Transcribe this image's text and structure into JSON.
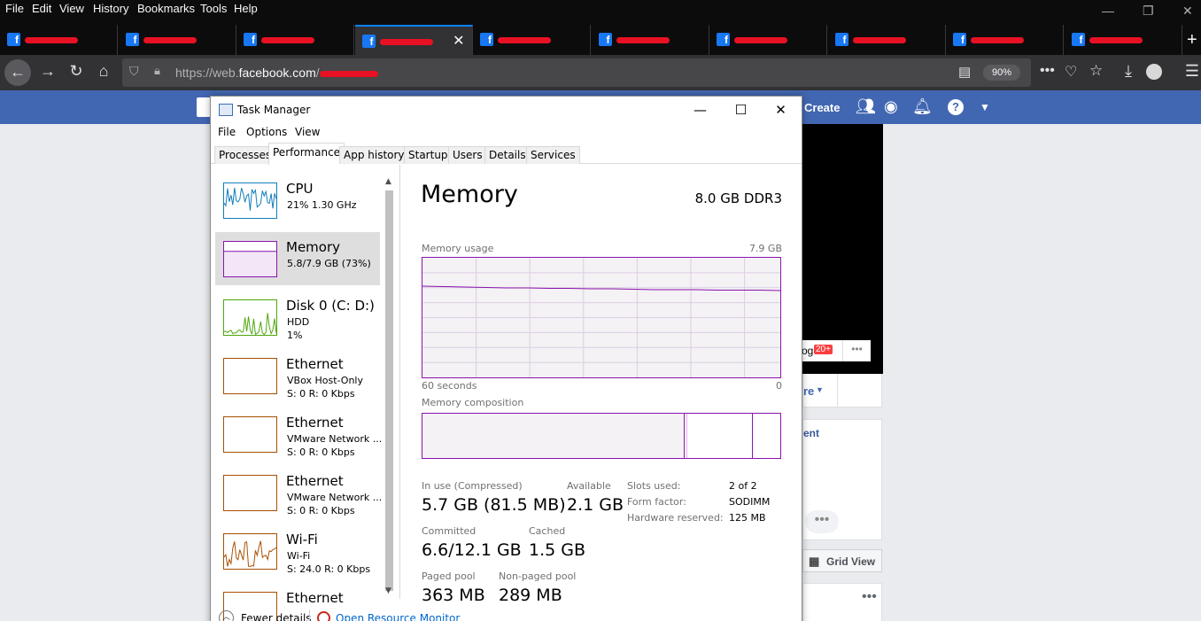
{
  "browser": {
    "menu": [
      "File",
      "Edit",
      "View",
      "History",
      "Bookmarks",
      "Tools",
      "Help"
    ],
    "url_prefix": "https://web.",
    "url_domain": "facebook.com",
    "url_suffix": "/",
    "zoom": "90%",
    "tab_count": 10,
    "active_tab_index": 3
  },
  "facebook": {
    "create_label": "Create",
    "badge_count": "20+",
    "badge_prefix": "og",
    "grid_view_label": "Grid View",
    "side_text_1": "re",
    "side_text_2": "ent",
    "brand_color": "#4267b2"
  },
  "taskmanager": {
    "title": "Task Manager",
    "menu": {
      "file": "File",
      "options": "Options",
      "view": "View"
    },
    "tabs": [
      "Processes",
      "Performance",
      "App history",
      "Startup",
      "Users",
      "Details",
      "Services"
    ],
    "active_tab": "Performance",
    "resources": [
      {
        "name": "CPU",
        "sub1": "21%  1.30 GHz",
        "sub2": "",
        "color": "#117dbb",
        "icon": "cpu-graph-icon"
      },
      {
        "name": "Memory",
        "sub1": "5.8/7.9 GB (73%)",
        "sub2": "",
        "color": "#8b12ae",
        "icon": "memory-graph-icon"
      },
      {
        "name": "Disk 0 (C: D:)",
        "sub1": "HDD",
        "sub2": "1%",
        "color": "#4da60c",
        "icon": "disk-graph-icon"
      },
      {
        "name": "Ethernet",
        "sub1": "VBox Host-Only",
        "sub2": "S: 0  R: 0 Kbps",
        "color": "#a74f01",
        "icon": "ethernet-graph-icon"
      },
      {
        "name": "Ethernet",
        "sub1": "VMware Network ...",
        "sub2": "S: 0  R: 0 Kbps",
        "color": "#a74f01",
        "icon": "ethernet-graph-icon"
      },
      {
        "name": "Ethernet",
        "sub1": "VMware Network ...",
        "sub2": "S: 0  R: 0 Kbps",
        "color": "#a74f01",
        "icon": "ethernet-graph-icon"
      },
      {
        "name": "Wi-Fi",
        "sub1": "Wi-Fi",
        "sub2": "S: 24.0  R: 0 Kbps",
        "color": "#a74f01",
        "icon": "wifi-graph-icon"
      },
      {
        "name": "Ethernet",
        "sub1": "",
        "sub2": "",
        "color": "#a74f01",
        "icon": "ethernet-graph-icon"
      }
    ],
    "memory": {
      "title": "Memory",
      "spec": "8.0 GB DDR3",
      "usage_label": "Memory usage",
      "usage_max": "7.9 GB",
      "time_left": "60 seconds",
      "time_right": "0",
      "composition_label": "Memory composition",
      "in_use_label": "In use (Compressed)",
      "in_use_value": "5.7 GB (81.5 MB)",
      "available_label": "Available",
      "available_value": "2.1 GB",
      "committed_label": "Committed",
      "committed_value": "6.6/12.1 GB",
      "cached_label": "Cached",
      "cached_value": "1.5 GB",
      "paged_label": "Paged pool",
      "paged_value": "363 MB",
      "nonpaged_label": "Non-paged pool",
      "nonpaged_value": "289 MB",
      "slots_label": "Slots used:",
      "slots_value": "2 of 2",
      "form_label": "Form factor:",
      "form_value": "SODIMM",
      "hwres_label": "Hardware reserved:",
      "hwres_value": "125 MB",
      "accent": "#8b12ae"
    },
    "bottom": {
      "fewer_details": "Fewer details",
      "resource_monitor": "Open Resource Monitor"
    }
  }
}
